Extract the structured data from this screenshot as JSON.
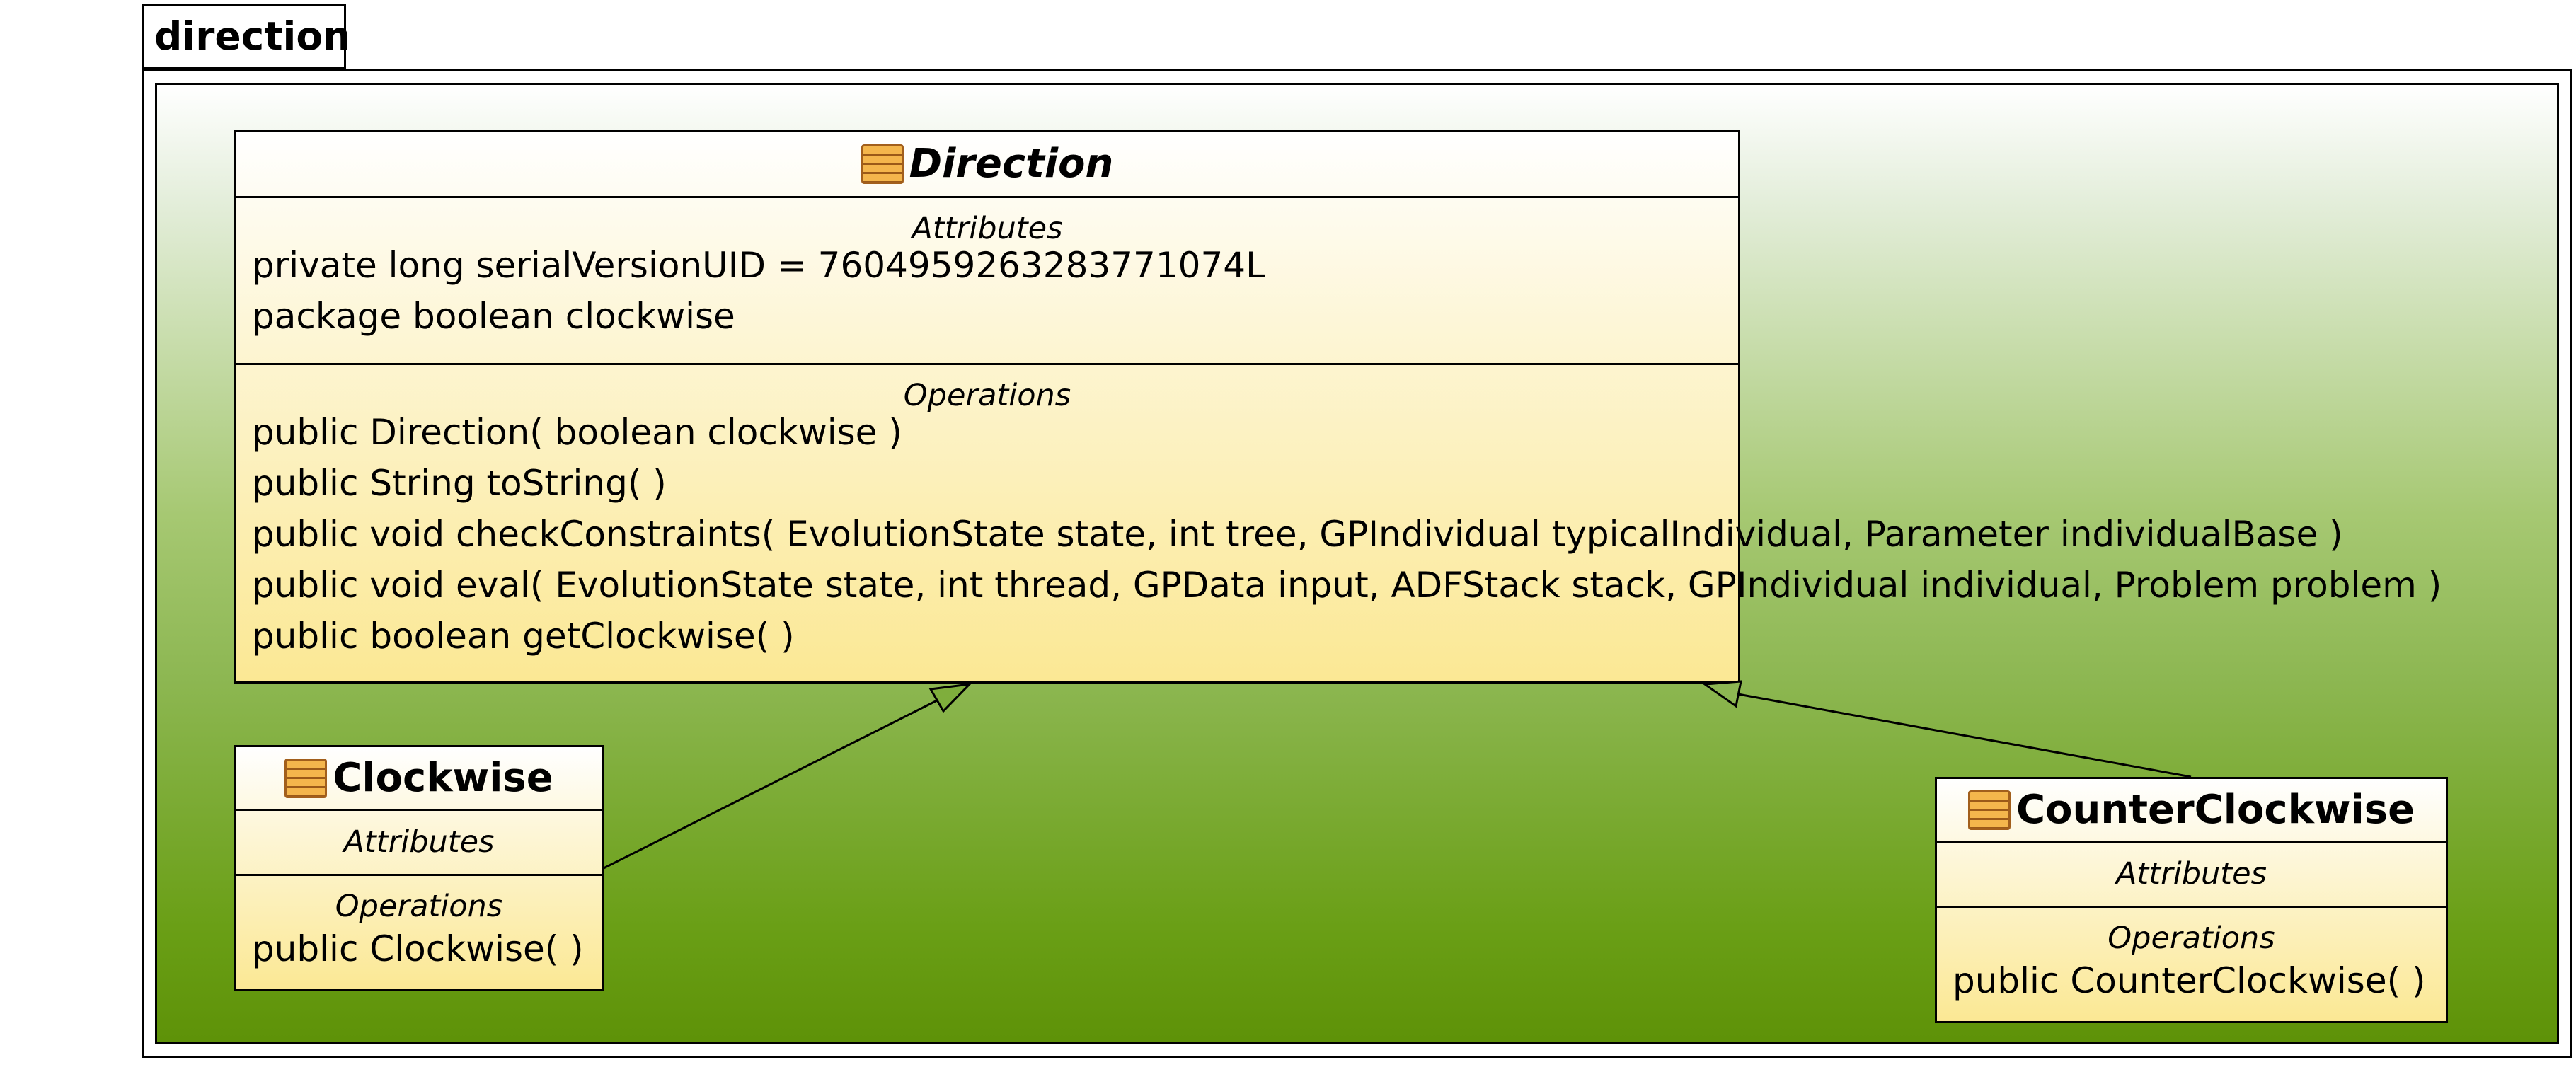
{
  "package": {
    "name": "direction"
  },
  "classes": {
    "direction": {
      "name": "Direction",
      "attributes_title": "Attributes",
      "attributes": [
        "private long serialVersionUID = 7604959263283771074L",
        "package boolean clockwise"
      ],
      "operations_title": "Operations",
      "operations": [
        "public Direction( boolean clockwise )",
        "public String  toString(  )",
        "public void  checkConstraints( EvolutionState state, int tree, GPIndividual typicalIndividual, Parameter individualBase )",
        "public void  eval( EvolutionState state, int thread, GPData input, ADFStack stack, GPIndividual individual, Problem problem )",
        "public boolean  getClockwise(  )"
      ]
    },
    "clockwise": {
      "name": "Clockwise",
      "attributes_title": "Attributes",
      "operations_title": "Operations",
      "operations": [
        "public Clockwise(  )"
      ]
    },
    "counter_clockwise": {
      "name": "CounterClockwise",
      "attributes_title": "Attributes",
      "operations_title": "Operations",
      "operations": [
        "public CounterClockwise(  )"
      ]
    }
  },
  "relations": [
    {
      "type": "generalization",
      "from": "Clockwise",
      "to": "Direction"
    },
    {
      "type": "generalization",
      "from": "CounterClockwise",
      "to": "Direction"
    }
  ],
  "colors": {
    "package_fill_top": "#ffffff",
    "package_fill_bottom": "#5e9208",
    "class_fill_top": "#ffffff",
    "class_fill_bottom": "#fbe894",
    "class_icon": "#f4b64c",
    "line": "#000000"
  }
}
